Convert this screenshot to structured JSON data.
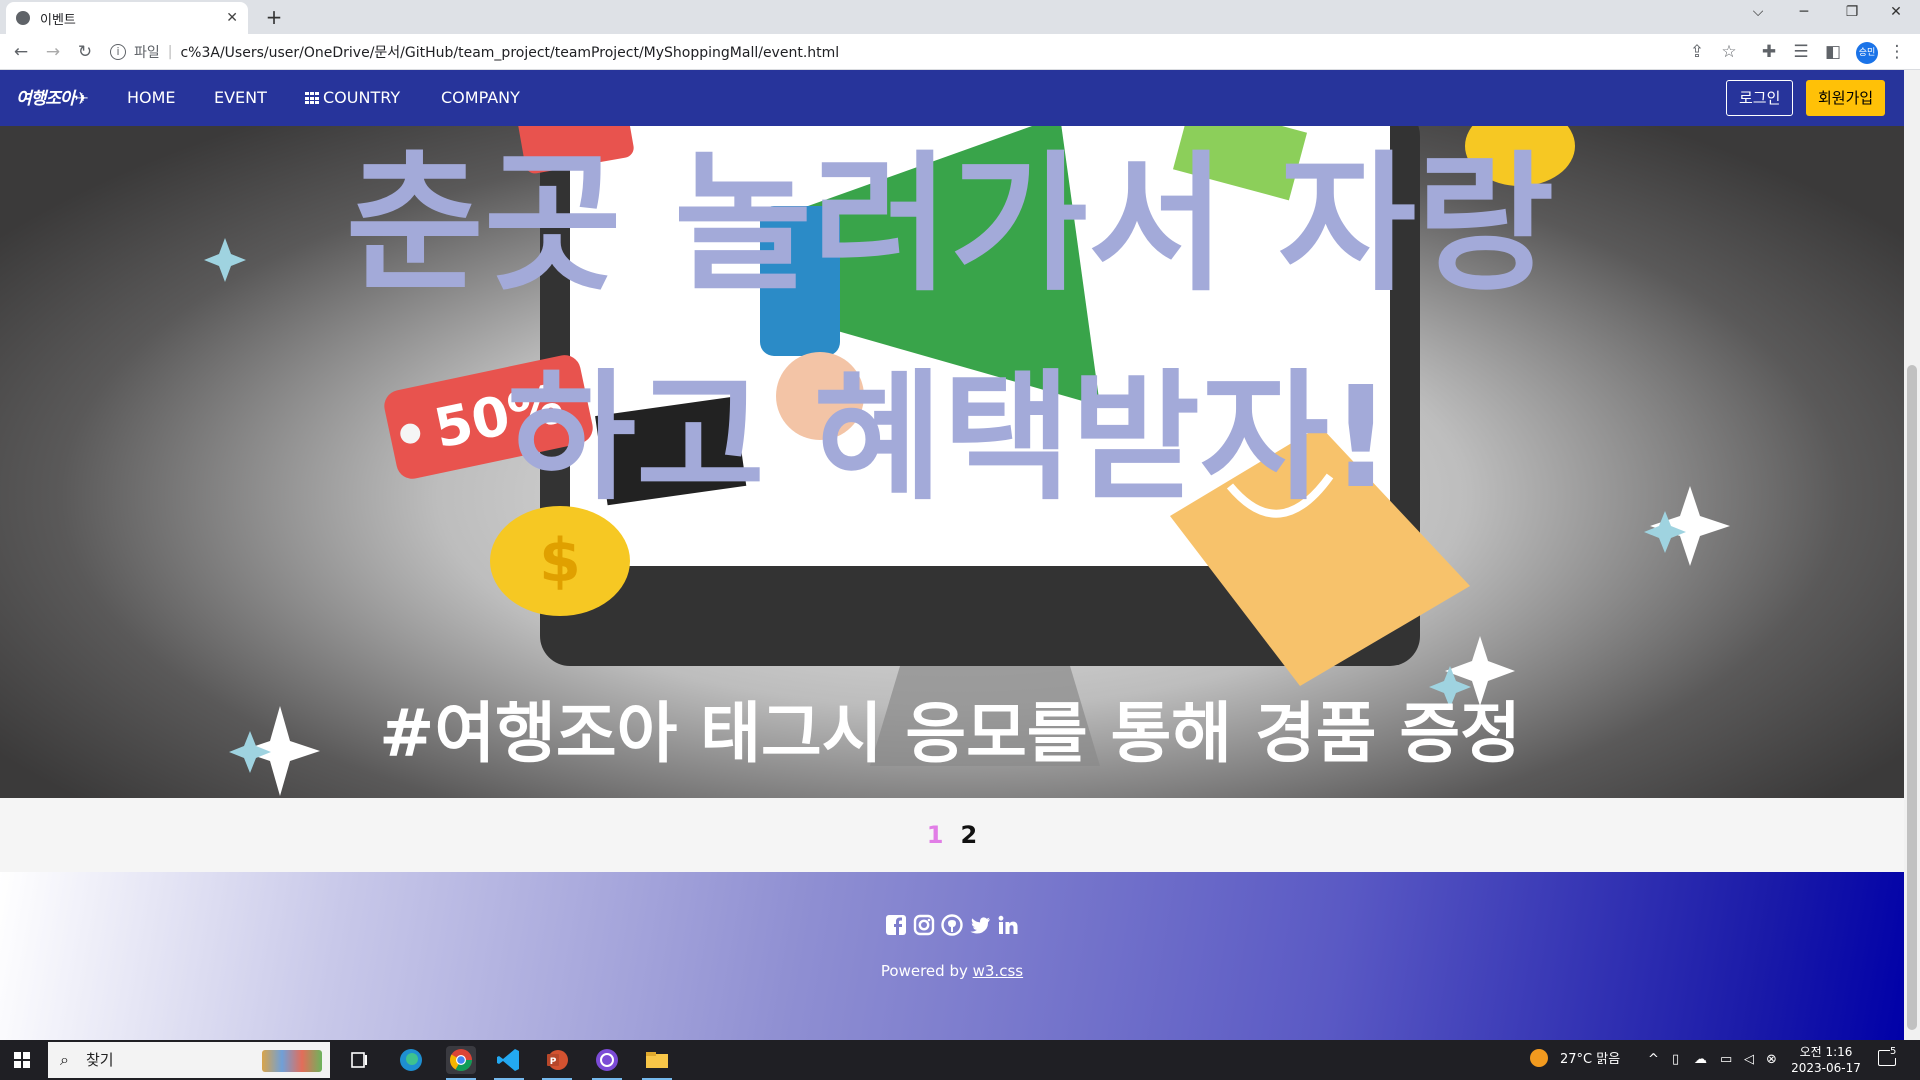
{
  "browser": {
    "tab_title": "이벤트",
    "new_tab": "+",
    "address": {
      "scheme": "파일",
      "url": "c%3A/Users/user/OneDrive/문서/GitHub/team_project/teamProject/MyShoppingMall/event.html"
    },
    "profile_label": "승민"
  },
  "site": {
    "logo": "여행조아✈",
    "nav": [
      "HOME",
      "EVENT",
      "COUNTRY",
      "COMPANY"
    ],
    "login": "로그인",
    "signup": "회원가입"
  },
  "banner": {
    "headline_line1": "춘곳 놀러가서 자랑",
    "headline_line2": "하고 혜택받자!",
    "subline": "#여행조아 태그시 응모를 통해 경품 증정",
    "price_tag": "50%",
    "coin_symbol": "$",
    "colors": {
      "headline": "#a3aad9",
      "subline": "#ffffff",
      "tag": "#e8534e",
      "coin": "#f6c823",
      "bag": "#f7c26b",
      "megaphone": "#39a44a"
    }
  },
  "pagination": {
    "pages": [
      "1",
      "2"
    ],
    "active": "1"
  },
  "footer": {
    "social_icons": [
      "facebook-icon",
      "instagram-icon",
      "github-icon",
      "twitter-icon",
      "linkedin-icon"
    ],
    "powered_prefix": "Powered by ",
    "powered_link": "w3.css"
  },
  "taskbar": {
    "search_placeholder": "찾기",
    "weather": "27°C 맑음",
    "time": "오전 1:16",
    "date": "2023-06-17",
    "notifications": "5"
  }
}
